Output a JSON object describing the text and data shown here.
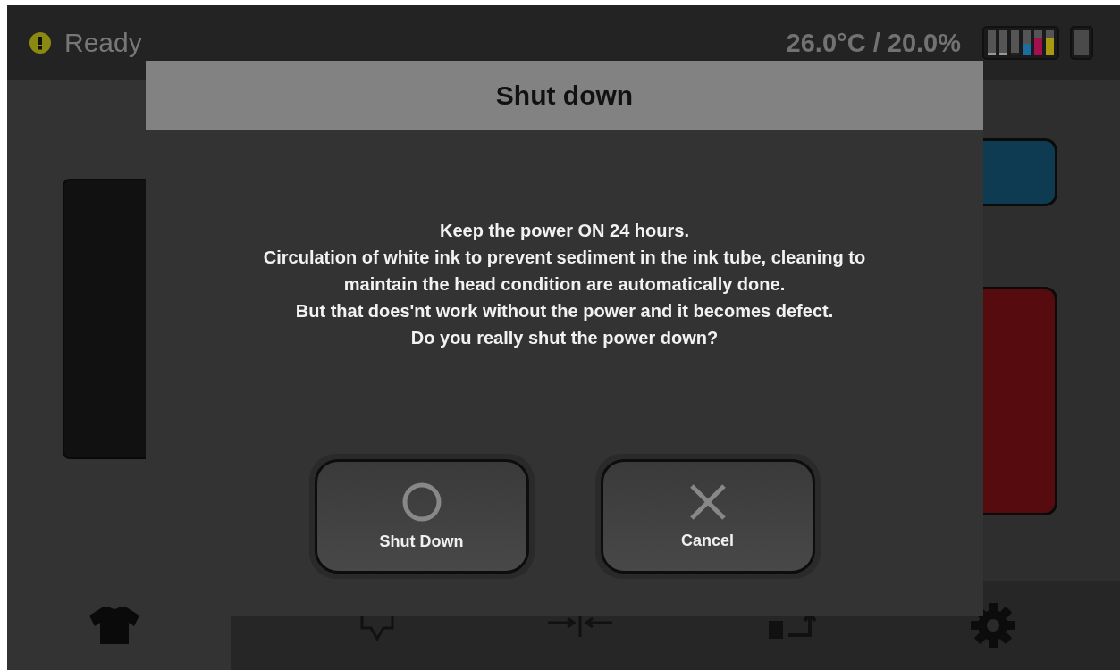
{
  "status_bar": {
    "kind": "warning",
    "status": "Ready",
    "readings": "26.0°C / 20.0%"
  },
  "dialog": {
    "title": "Shut down",
    "message": [
      "Keep the power ON 24 hours.",
      "Circulation of white ink to prevent sediment in the ink tube, cleaning to",
      "maintain the head condition are automatically done.",
      "But that does'nt work without the power and it becomes defect.",
      "Do you really shut the power down?"
    ],
    "buttons": [
      {
        "kind": "confirm",
        "label": "Shut Down"
      },
      {
        "kind": "cancel",
        "label": "Cancel"
      }
    ]
  }
}
